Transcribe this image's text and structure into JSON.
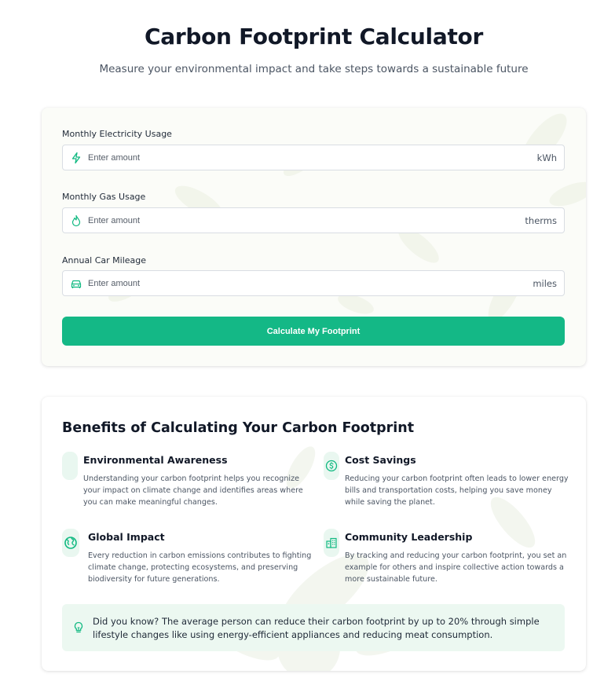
{
  "header": {
    "title": "Carbon Footprint Calculator",
    "subtitle": "Measure your environmental impact and take steps towards a sustainable future"
  },
  "calculator": {
    "fields": [
      {
        "label": "Monthly Electricity Usage",
        "placeholder": "Enter amount",
        "value": "",
        "unit": "kWh",
        "icon": "lightning-icon"
      },
      {
        "label": "Monthly Gas Usage",
        "placeholder": "Enter amount",
        "value": "",
        "unit": "therms",
        "icon": "flame-icon"
      },
      {
        "label": "Annual Car Mileage",
        "placeholder": "Enter amount",
        "value": "",
        "unit": "miles",
        "icon": "car-icon"
      }
    ],
    "button_label": "Calculate My Footprint"
  },
  "benefits": {
    "title": "Benefits of Calculating Your Carbon Footprint",
    "items": [
      {
        "title": "Environmental Awareness",
        "description": "Understanding your carbon footprint helps you recognize your impact on climate change and identifies areas where you can make meaningful changes.",
        "icon": "awareness-icon"
      },
      {
        "title": "Cost Savings",
        "description": "Reducing your carbon footprint often leads to lower energy bills and transportation costs, helping you save money while saving the planet.",
        "icon": "dollar-icon"
      },
      {
        "title": "Global Impact",
        "description": "Every reduction in carbon emissions contributes to fighting climate change, protecting ecosystems, and preserving biodiversity for future generations.",
        "icon": "globe-icon"
      },
      {
        "title": "Community Leadership",
        "description": "By tracking and reducing your carbon footprint, you set an example for others and inspire collective action towards a more sustainable future.",
        "icon": "building-icon"
      }
    ],
    "tip": {
      "text": "Did you know? The average person can reduce their carbon footprint by up to 20% through simple lifestyle changes like using energy-efficient appliances and reducing meat consumption.",
      "icon": "lightbulb-icon"
    }
  },
  "colors": {
    "accent": "#14b886",
    "icon_green": "#10b981",
    "tip_background": "#ecf8f1",
    "title_text": "#111827"
  }
}
